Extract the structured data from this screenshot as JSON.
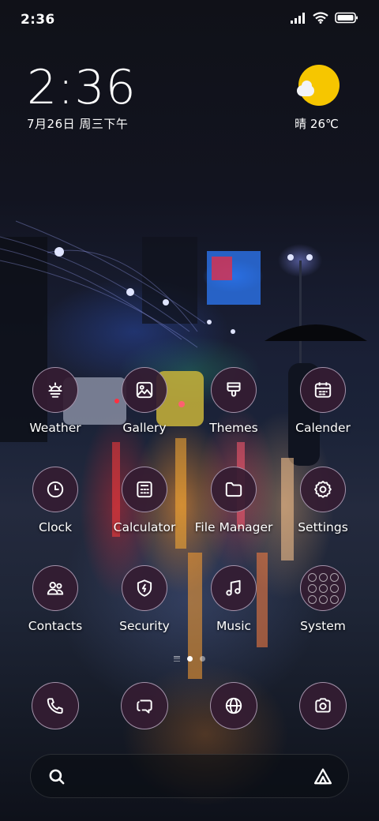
{
  "status_bar": {
    "time": "2:36",
    "icons": [
      "signal-icon",
      "wifi-icon",
      "battery-icon"
    ]
  },
  "clock_widget": {
    "time": "2:36",
    "date": "7月26日 周三下午"
  },
  "weather_widget": {
    "icon": "sun-cloud-icon",
    "text": "晴 26℃"
  },
  "apps": [
    {
      "label": "Weather",
      "icon": "weather-icon"
    },
    {
      "label": "Gallery",
      "icon": "gallery-icon"
    },
    {
      "label": "Themes",
      "icon": "themes-icon"
    },
    {
      "label": "Calender",
      "icon": "calendar-icon"
    },
    {
      "label": "Clock",
      "icon": "clock-icon"
    },
    {
      "label": "Calculator",
      "icon": "calculator-icon"
    },
    {
      "label": "File Manager",
      "icon": "folder-icon"
    },
    {
      "label": "Settings",
      "icon": "gear-icon"
    },
    {
      "label": "Contacts",
      "icon": "contacts-icon"
    },
    {
      "label": "Security",
      "icon": "shield-icon"
    },
    {
      "label": "Music",
      "icon": "music-icon"
    },
    {
      "label": "System",
      "icon": "folder-grid-icon"
    }
  ],
  "page_indicator": {
    "pages": 2,
    "active": 1
  },
  "dock": [
    {
      "name": "phone",
      "icon": "phone-icon"
    },
    {
      "name": "messages",
      "icon": "message-icon"
    },
    {
      "name": "browser",
      "icon": "globe-icon"
    },
    {
      "name": "camera",
      "icon": "camera-icon"
    }
  ],
  "search_bar": {
    "left_icon": "search-icon",
    "right_icon": "assistant-icon"
  },
  "colors": {
    "icon_bg": "#341c32",
    "icon_border": "#c8b9d2",
    "sun": "#f6c600"
  }
}
